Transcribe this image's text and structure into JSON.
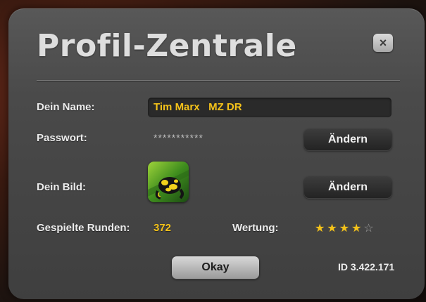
{
  "dialog": {
    "title": "Profil-Zentrale",
    "close_label": "×",
    "name_label": "Dein Name:",
    "name_value": "Tim Marx   MZ DR",
    "password_label": "Passwort:",
    "password_value": "***********",
    "password_change_label": "Ändern",
    "picture_label": "Dein Bild:",
    "picture_change_label": "Ändern",
    "avatar_icon": "frog-avatar",
    "rounds_label": "Gespielte Runden:",
    "rounds_value": "372",
    "rating_label": "Wertung:",
    "rating_value": 4,
    "rating_max": 5,
    "star_on": "★",
    "star_off": "☆",
    "okay_label": "Okay",
    "id_text": "ID 3.422.171"
  },
  "colors": {
    "accent": "#f4c21a",
    "panel": "#4a4a4a"
  }
}
